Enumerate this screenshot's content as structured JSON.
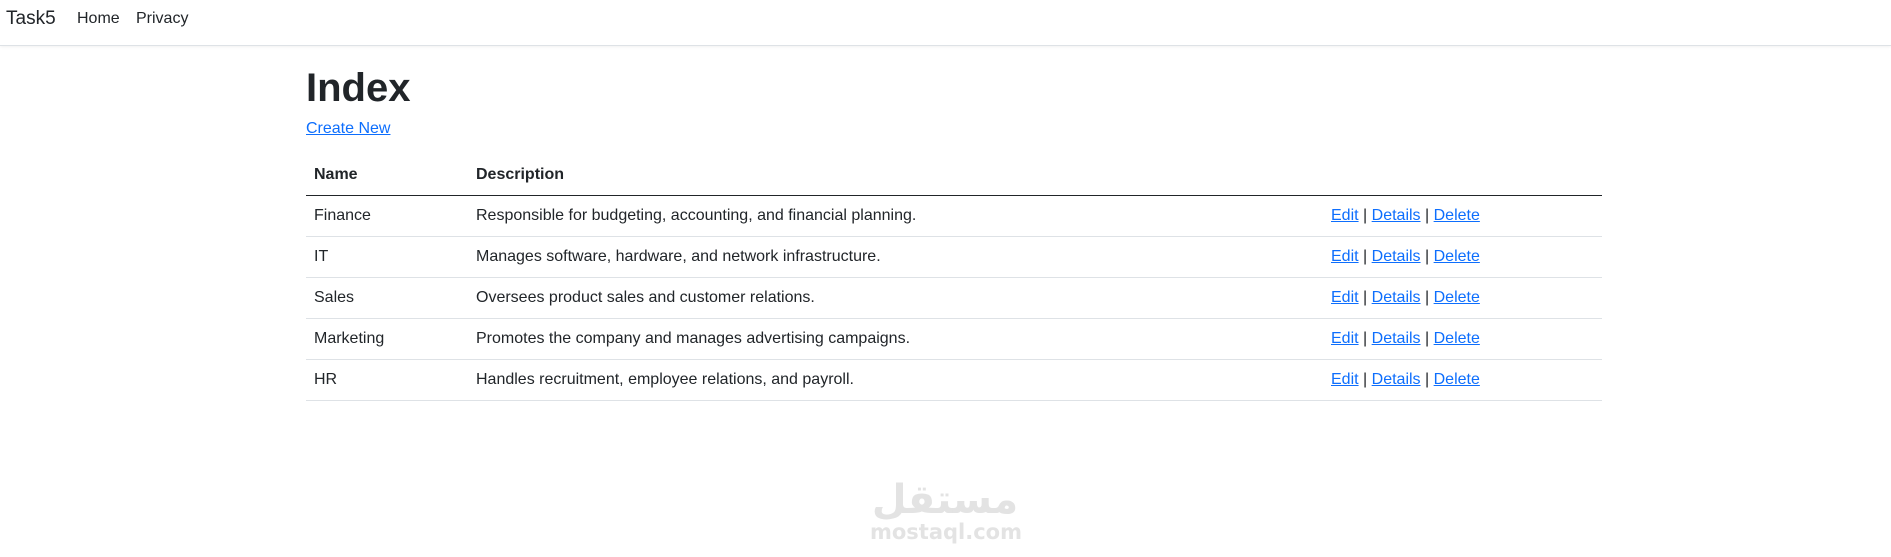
{
  "nav": {
    "brand": "Task5",
    "links": [
      "Home",
      "Privacy"
    ]
  },
  "page": {
    "title": "Index",
    "create_label": "Create New"
  },
  "table": {
    "headers": [
      "Name",
      "Description"
    ],
    "rows": [
      {
        "name": "Finance",
        "description": "Responsible for budgeting, accounting, and financial planning."
      },
      {
        "name": "IT",
        "description": "Manages software, hardware, and network infrastructure."
      },
      {
        "name": "Sales",
        "description": "Oversees product sales and customer relations."
      },
      {
        "name": "Marketing",
        "description": "Promotes the company and manages advertising campaigns."
      },
      {
        "name": "HR",
        "description": "Handles recruitment, employee relations, and payroll."
      }
    ],
    "actions": {
      "edit": "Edit",
      "details": "Details",
      "delete": "Delete",
      "separator": "|"
    }
  },
  "watermark": {
    "arabic": "مستقل",
    "latin": "mostaql.com"
  },
  "colors": {
    "link": "#0d6efd",
    "text": "#212529",
    "border": "#dee2e6"
  }
}
